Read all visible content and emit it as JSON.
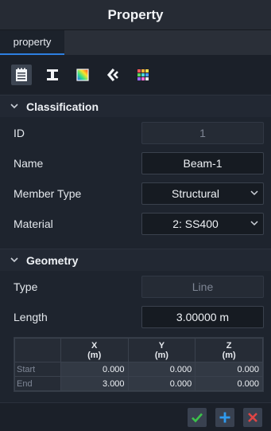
{
  "window": {
    "title": "Property"
  },
  "tabs": [
    {
      "label": "property"
    }
  ],
  "toolbar": {
    "icons": [
      {
        "name": "property-list-icon",
        "active": true
      },
      {
        "name": "section-profile-icon",
        "active": false
      },
      {
        "name": "color-map-icon",
        "active": false
      },
      {
        "name": "connection-icon",
        "active": false
      },
      {
        "name": "palette-grid-icon",
        "active": false
      }
    ]
  },
  "classification": {
    "title": "Classification",
    "id": {
      "label": "ID",
      "value": "1"
    },
    "name": {
      "label": "Name",
      "value": "Beam-1"
    },
    "member_type": {
      "label": "Member Type",
      "value": "Structural"
    },
    "material": {
      "label": "Material",
      "value": "2: SS400"
    }
  },
  "geometry": {
    "title": "Geometry",
    "type": {
      "label": "Type",
      "value": "Line"
    },
    "length": {
      "label": "Length",
      "value": "3.00000 m"
    },
    "table": {
      "columns": [
        {
          "axis": "X",
          "unit": "(m)"
        },
        {
          "axis": "Y",
          "unit": "(m)"
        },
        {
          "axis": "Z",
          "unit": "(m)"
        }
      ],
      "rows": [
        {
          "label": "Start",
          "values": [
            "0.000",
            "0.000",
            "0.000"
          ]
        },
        {
          "label": "End",
          "values": [
            "3.000",
            "0.000",
            "0.000"
          ]
        }
      ]
    }
  },
  "footer": {
    "buttons": [
      {
        "name": "confirm-icon",
        "color": "#3cc24a"
      },
      {
        "name": "add-icon",
        "color": "#2f9bf0"
      },
      {
        "name": "close-icon",
        "color": "#e04545"
      }
    ]
  },
  "colors": {
    "accent": "#2d7fe0",
    "background": "#1e242e"
  }
}
